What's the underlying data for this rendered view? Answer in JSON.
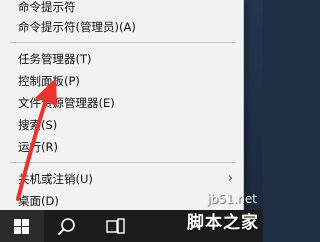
{
  "context_menu": {
    "items": [
      {
        "label": "命令提示符",
        "partial": true
      },
      {
        "label": "命令提示符(管理员)(A)"
      },
      {
        "label": "任务管理器(T)"
      },
      {
        "label": "控制面板(P)"
      },
      {
        "label": "文件资源管理器(E)"
      },
      {
        "label": "搜索(S)"
      },
      {
        "label": "运行(R)"
      },
      {
        "label": "关机或注销(U)",
        "has_submenu": true
      },
      {
        "label": "桌面(D)"
      }
    ],
    "submenu_chevron": "›"
  },
  "taskbar": {
    "start_icon": "windows-logo-icon",
    "search_icon": "search-icon",
    "taskview_icon": "task-view-icon"
  },
  "annotation": {
    "arrow_color": "#e8352e"
  },
  "watermark": {
    "site": "jb51.net",
    "brand": "脚本之家"
  },
  "colors": {
    "menu_bg": "#f2f2f2",
    "taskbar_bg": "#1c1c1c",
    "desktop_bg": "#1f2f46"
  }
}
